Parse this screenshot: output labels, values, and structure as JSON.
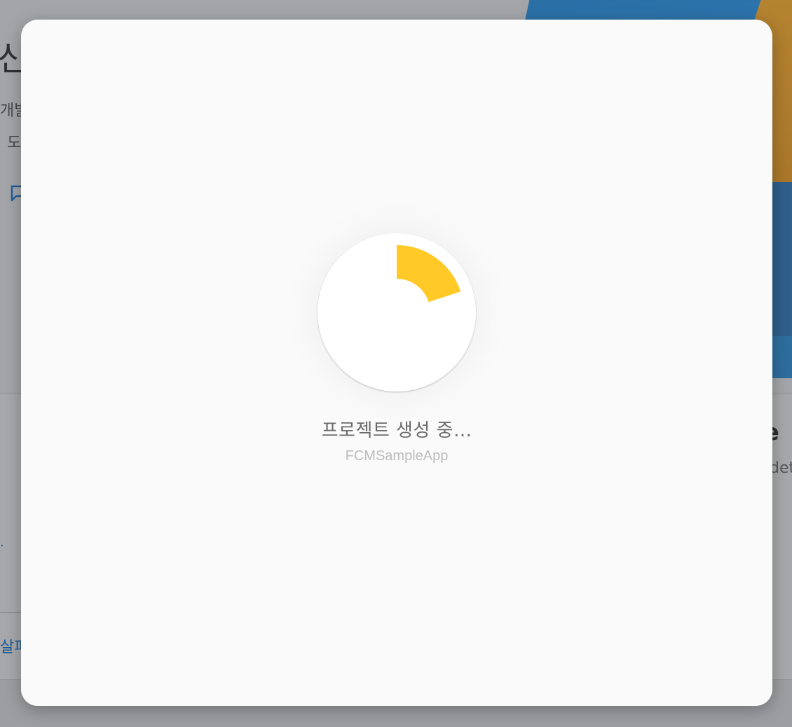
{
  "background": {
    "title_fragment": "신",
    "line1_fragment": "개발",
    "line2_fragment": "도",
    "right_heading_fragment": "e",
    "right_sub_fragment": "det",
    "link_fragment": "살파",
    "chat_icon": "chat-icon"
  },
  "dialog": {
    "status": "프로젝트 생성 중...",
    "project_name": "FCMSampleApp",
    "spinner": {
      "icon": "loading-spinner-icon",
      "color": "#ffca28"
    }
  },
  "colors": {
    "accent": "#ffca28",
    "overlay": "#9fa1a5",
    "dialog_bg": "#fafafa"
  }
}
